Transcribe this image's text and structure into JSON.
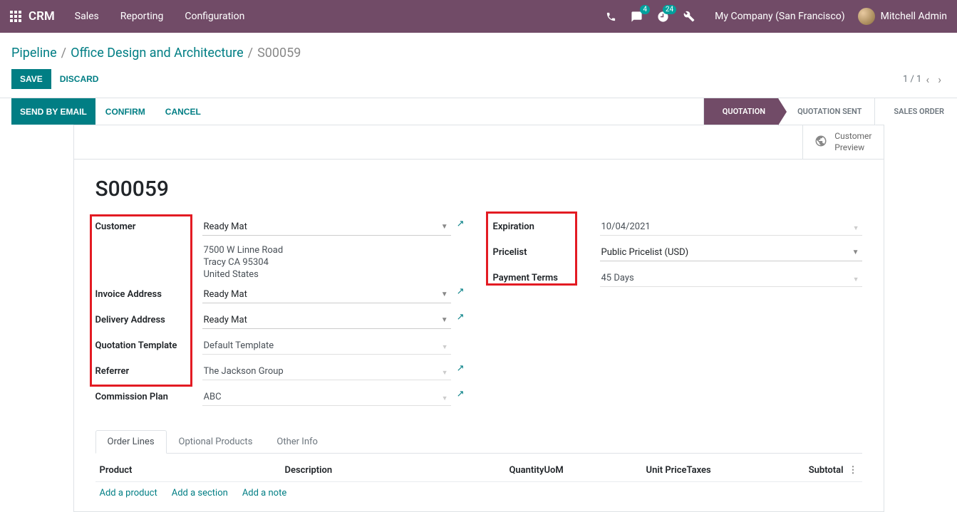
{
  "topbar": {
    "brand": "CRM",
    "menu": [
      "Sales",
      "Reporting",
      "Configuration"
    ],
    "msg_badge": "4",
    "activity_badge": "24",
    "company": "My Company (San Francisco)",
    "user": "Mitchell Admin"
  },
  "breadcrumb": {
    "items": [
      "Pipeline",
      "Office Design and Architecture"
    ],
    "current": "S00059"
  },
  "actions": {
    "save": "SAVE",
    "discard": "DISCARD",
    "pager": "1 / 1"
  },
  "statusbar": {
    "send": "SEND BY EMAIL",
    "confirm": "CONFIRM",
    "cancel": "CANCEL",
    "steps": [
      "QUOTATION",
      "QUOTATION SENT",
      "SALES ORDER"
    ]
  },
  "sheet": {
    "preview": "Customer\nPreview",
    "title": "S00059",
    "left_labels": {
      "customer": "Customer",
      "invoice": "Invoice Address",
      "delivery": "Delivery Address",
      "template": "Quotation Template",
      "referrer": "Referrer",
      "commission": "Commission Plan"
    },
    "right_labels": {
      "expiration": "Expiration",
      "pricelist": "Pricelist",
      "payment_terms": "Payment Terms"
    },
    "left_values": {
      "customer": "Ready Mat",
      "addr1": "7500 W Linne Road",
      "addr2": "Tracy CA 95304",
      "addr3": "United States",
      "invoice": "Ready Mat",
      "delivery": "Ready Mat",
      "template": "Default Template",
      "referrer": "The Jackson Group",
      "commission": "ABC"
    },
    "right_values": {
      "expiration": "10/04/2021",
      "pricelist": "Public Pricelist (USD)",
      "payment_terms": "45 Days"
    }
  },
  "tabs": [
    "Order Lines",
    "Optional Products",
    "Other Info"
  ],
  "orderlines": {
    "headers": {
      "product": "Product",
      "description": "Description",
      "quantity": "Quantity",
      "uom": "UoM",
      "unit_price": "Unit Price",
      "taxes": "Taxes",
      "subtotal": "Subtotal"
    },
    "actions": {
      "add_product": "Add a product",
      "add_section": "Add a section",
      "add_note": "Add a note"
    }
  }
}
